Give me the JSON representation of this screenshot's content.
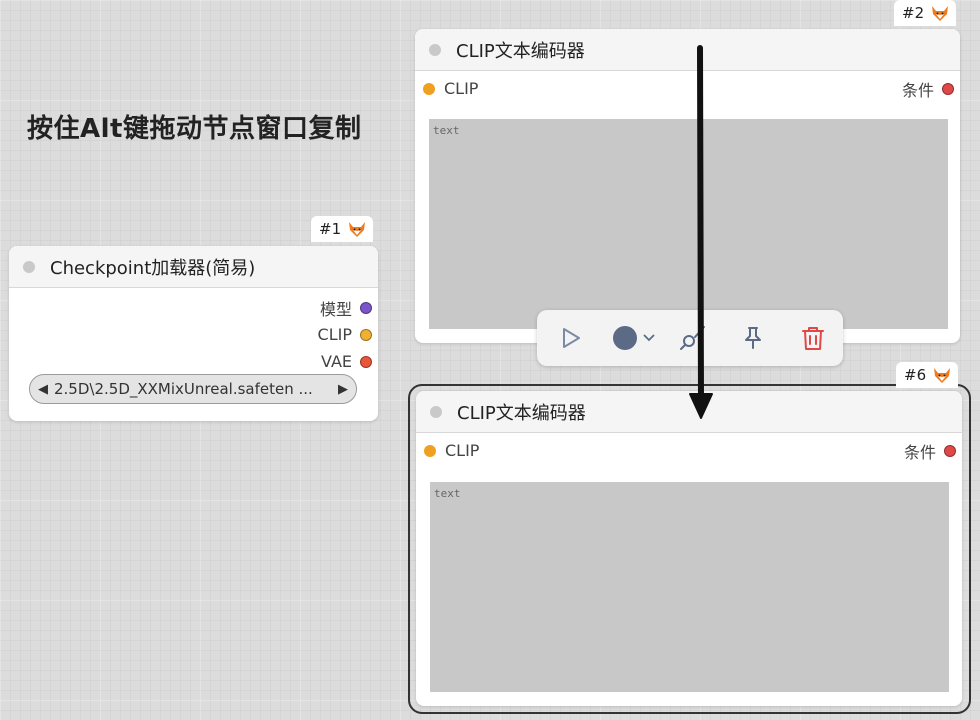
{
  "overlay": {
    "instruction": "按住Alt键拖动节点窗口复制"
  },
  "nodes": {
    "checkpoint": {
      "id": "#1",
      "title": "Checkpoint加载器(简易)",
      "outputs": [
        {
          "label": "模型",
          "color": "#7b55c9"
        },
        {
          "label": "CLIP",
          "color": "#f0b030"
        },
        {
          "label": "VAE",
          "color": "#e8553a"
        }
      ],
      "ckpt_value": "2.5D\\2.5D_XXMixUnreal.safeten ..."
    },
    "clip_top": {
      "id": "#2",
      "title": "CLIP文本编码器",
      "input": {
        "label": "CLIP",
        "color": "#f0a020"
      },
      "output": {
        "label": "条件",
        "color": "#e04848"
      },
      "text_placeholder": "text"
    },
    "clip_bottom": {
      "id": "#6",
      "title": "CLIP文本编码器",
      "input": {
        "label": "CLIP",
        "color": "#f0a020"
      },
      "output": {
        "label": "条件",
        "color": "#e04848"
      },
      "text_placeholder": "text"
    }
  },
  "toolbar": {
    "buttons": [
      {
        "icon": "play-icon"
      },
      {
        "icon": "color-circle-icon",
        "color": "#5b6b86"
      },
      {
        "icon": "bypass-wand-icon"
      },
      {
        "icon": "pin-icon"
      },
      {
        "icon": "trash-icon",
        "color": "#e04848"
      }
    ]
  },
  "colors": {
    "canvas": "#dcdcdc",
    "node_body": "#ffffff",
    "node_header": "#f5f5f5",
    "textarea": "#c8c8c8"
  }
}
